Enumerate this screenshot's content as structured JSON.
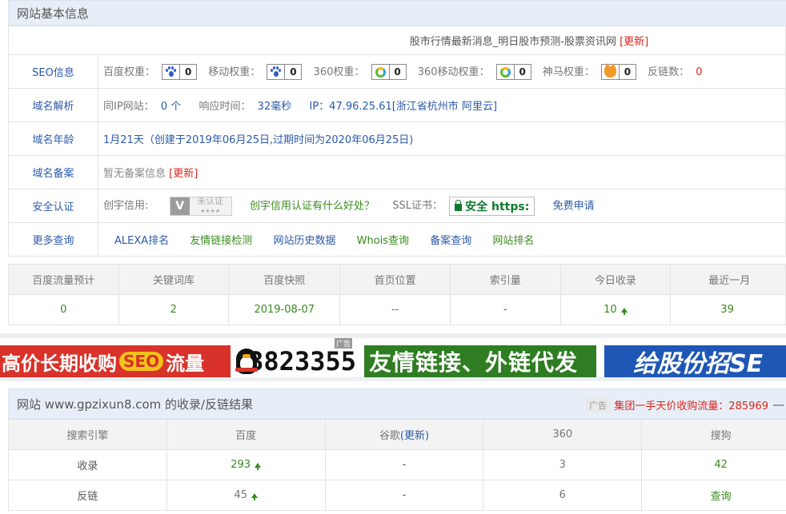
{
  "section_title": "网站基本信息",
  "site_title": "股市行情最新消息_明日股市预测-股票资讯网",
  "update_label": "[更新]",
  "seo": {
    "label": "SEO信息",
    "baidu_label": "百度权重：",
    "baidu_value": "0",
    "mobile_label": "移动权重：",
    "mobile_value": "0",
    "s360_label": "360权重：",
    "s360_value": "0",
    "s360m_label": "360移动权重：",
    "s360m_value": "0",
    "shenma_label": "神马权重：",
    "shenma_value": "0",
    "backlink_label": "反链数：",
    "backlink_value": "0"
  },
  "domain_resolve": {
    "label": "域名解析",
    "same_ip_label": "同IP网站：",
    "same_ip_value": "0 个",
    "response_label": "响应时间：",
    "response_value": "32毫秒",
    "ip_text": "IP：47.96.25.61[浙江省杭州市 阿里云]"
  },
  "domain_age": {
    "label": "域名年龄",
    "value": "1月21天（创建于2019年06月25日,过期时间为2020年06月25日)"
  },
  "domain_icp": {
    "label": "域名备案",
    "value": "暂无备案信息",
    "update": "[更新]"
  },
  "security": {
    "label": "安全认证",
    "chuangyu_label": "创宇信用:",
    "cert_mark": "V",
    "cert_text": "未认证",
    "cert_stars": "★★★★",
    "benefit_link": "创宇信用认证有什么好处？",
    "ssl_label": "SSL证书：",
    "https_text": "安全 https:",
    "free_apply": "免费申请"
  },
  "more": {
    "label": "更多查询",
    "links": [
      "ALEXA排名",
      "友情链接检测",
      "网站历史数据",
      "Whois查询",
      "备案查询",
      "网站排名"
    ]
  },
  "stats": {
    "headers": [
      "百度流量预计",
      "关键词库",
      "百度快照",
      "首页位置",
      "索引量",
      "今日收录",
      "最近一月"
    ],
    "values": [
      "0",
      "2",
      "2019-08-07",
      "--",
      "-",
      "10",
      "39"
    ]
  },
  "ads": {
    "ad1_a": "高价长期收购",
    "ad1_seo": "SEO",
    "ad1_b": "流量",
    "ad2": "3823355",
    "ad2_tag": "广告",
    "ad3": "友情链接、外链代发",
    "ad4": "给股份招SE"
  },
  "result": {
    "title": "网站 www.gpzixun8.com 的收录/反链结果",
    "ad_badge": "广告",
    "ad_link": "集团一手天价收购流量：285969",
    "dash": "—",
    "headers": [
      "搜索引擎",
      "百度",
      "谷歌",
      "360",
      "搜狗"
    ],
    "google_update": "(更新)",
    "rows": [
      {
        "name": "收录",
        "baidu": "293",
        "google": "-",
        "s360": "3",
        "sogou": "42"
      },
      {
        "name": "反链",
        "baidu": "45",
        "google": "-",
        "s360": "6",
        "sogou": "查询"
      }
    ]
  }
}
